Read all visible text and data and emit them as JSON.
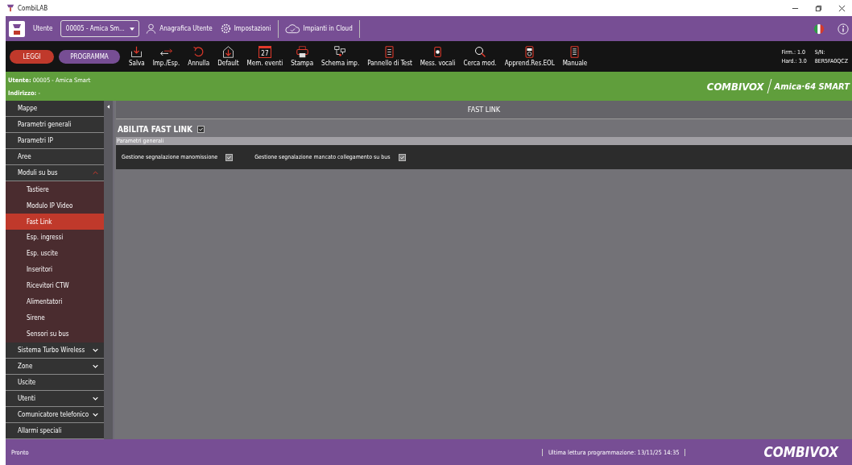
{
  "window": {
    "title": "CombiLAB"
  },
  "top_bar": {
    "user_label": "Utente",
    "user_select": "00005 - Amica Sm...",
    "links": [
      {
        "kind": "user",
        "label": "Anagrafica Utente"
      },
      {
        "kind": "gear",
        "label": "Impostazioni"
      },
      {
        "kind": "cloud",
        "label": "Impianti in Cloud"
      }
    ]
  },
  "toolbar": {
    "read_button": "LEGGI",
    "program_button": "PROGRAMMA",
    "tools": [
      {
        "kind": "download",
        "label": "Salva"
      },
      {
        "kind": "swap",
        "label": "Imp./Esp."
      },
      {
        "kind": "undo",
        "label": "Annulla"
      },
      {
        "kind": "house",
        "label": "Default"
      },
      {
        "kind": "calendar",
        "label": "Mem. eventi",
        "icon_text": "27"
      },
      {
        "kind": "printer",
        "label": "Stampa"
      },
      {
        "kind": "network",
        "label": "Schema imp."
      },
      {
        "kind": "panel",
        "label": "Pannello di Test"
      },
      {
        "kind": "speaker",
        "label": "Mess. vocali"
      },
      {
        "kind": "search",
        "label": "Cerca mod."
      },
      {
        "kind": "meter",
        "label": "Apprend.Res.EOL"
      },
      {
        "kind": "document",
        "label": "Manuale"
      }
    ],
    "device_info": [
      {
        "label": "Firm.: 1.0",
        "value": "S/N:"
      },
      {
        "label": "Hard.: 3.0",
        "value": "8ER5FA0QCZ"
      }
    ]
  },
  "info_bar": {
    "user": "**Utente:** 00005 - Amica Smart",
    "address": "**Indirizzo:** -",
    "brand": "COMBIVOX",
    "product": "Amica·64 SMART"
  },
  "sidebar": {
    "items": [
      {
        "label": "Mappe",
        "selected": false
      },
      {
        "label": "Parametri generali",
        "selected": false
      },
      {
        "label": "Parametri IP",
        "selected": false
      },
      {
        "label": "Aree",
        "selected": false
      },
      {
        "label": "Moduli su bus",
        "selected": false,
        "expanded": true,
        "children": [
          {
            "label": "Tastiere",
            "selected": false
          },
          {
            "label": "Modulo IP Video",
            "selected": false
          },
          {
            "label": "Fast Link",
            "selected": true
          },
          {
            "label": "Esp. ingressi",
            "selected": false
          },
          {
            "label": "Esp. uscite",
            "selected": false
          },
          {
            "label": "Inseritori",
            "selected": false
          },
          {
            "label": "Ricevitori CTW",
            "selected": false
          },
          {
            "label": "Alimentatori",
            "selected": false
          },
          {
            "label": "Sirene",
            "selected": false
          },
          {
            "label": "Sensori su bus",
            "selected": false
          }
        ]
      },
      {
        "label": "Sistema Turbo Wireless",
        "selected": false,
        "expanded": false
      },
      {
        "label": "Zone",
        "selected": false,
        "expanded": false
      },
      {
        "label": "Uscite",
        "selected": false
      },
      {
        "label": "Utenti",
        "selected": false,
        "expanded": false
      },
      {
        "label": "Comunicatore telefonico",
        "selected": false,
        "expanded": false
      },
      {
        "label": "Allarmi speciali",
        "selected": false
      }
    ]
  },
  "content": {
    "header": "FAST LINK",
    "enable": {
      "label": "ABILITA FAST LINK",
      "checked": true
    },
    "section": {
      "title": "Parametri generali",
      "options": [
        {
          "label": "Gestione segnalazione manomissione",
          "checked": true
        },
        {
          "label": "Gestione segnalazione mancato collegamento su bus",
          "checked": true
        }
      ]
    }
  },
  "status_bar": {
    "status": "Pronto",
    "last_read": "Ultima lettura programmazione: 13/11/25 14:35",
    "brand": "COMBIVOX"
  }
}
